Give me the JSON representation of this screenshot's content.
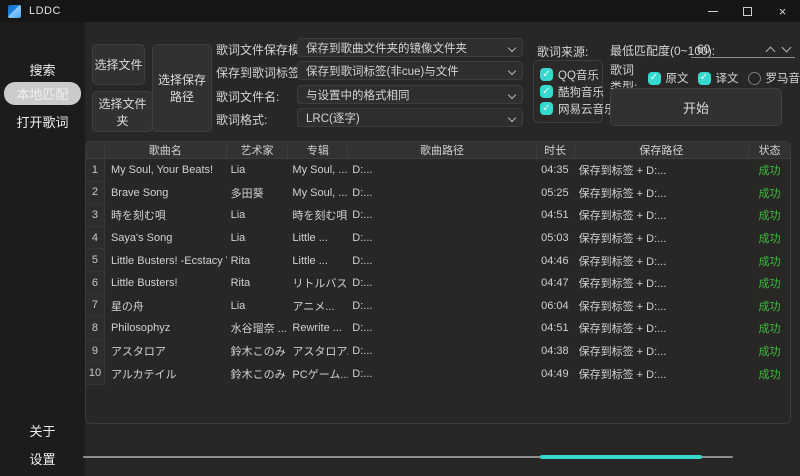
{
  "window": {
    "title": "LDDC"
  },
  "sidebar": {
    "items": [
      {
        "label": "搜索"
      },
      {
        "label": "本地匹配",
        "active": true
      },
      {
        "label": "打开歌词"
      }
    ],
    "footer": [
      {
        "label": "关于"
      },
      {
        "label": "设置"
      }
    ]
  },
  "toolbar": {
    "select_file": "选择文件",
    "select_folder": "选择文件夹",
    "select_save_path": "选择保存路径",
    "fields": [
      {
        "label": "歌词文件保存模式:",
        "value": "保存到歌曲文件夹的镜像文件夹"
      },
      {
        "label": "保存到歌词标签:",
        "value": "保存到歌词标签(非cue)与文件"
      },
      {
        "label": "歌词文件名:",
        "value": "与设置中的格式相同"
      },
      {
        "label": "歌词格式:",
        "value": "LRC(逐字)"
      }
    ],
    "source": {
      "label": "歌词来源:",
      "options": [
        {
          "label": "QQ音乐",
          "checked": true
        },
        {
          "label": "酷狗音乐",
          "checked": true
        },
        {
          "label": "网易云音乐",
          "checked": true
        }
      ]
    },
    "match": {
      "label": "最低匹配度(0~100):",
      "value": "60"
    },
    "types": {
      "label": "歌词类型:",
      "options": [
        {
          "label": "原文",
          "checked": true
        },
        {
          "label": "译文",
          "checked": true
        },
        {
          "label": "罗马音",
          "checked": false
        }
      ]
    },
    "start": "开始"
  },
  "table": {
    "headers": [
      "歌曲名",
      "艺术家",
      "专辑",
      "歌曲路径",
      "时长",
      "保存路径",
      "状态"
    ],
    "rows": [
      {
        "num": "1",
        "song": "My Soul, Your Beats!",
        "artist": "Lia",
        "album": "My Soul, ...",
        "path": "D:...",
        "duration": "04:35",
        "save": "保存到标签 + D:...",
        "status": "成功"
      },
      {
        "num": "2",
        "song": "Brave Song",
        "artist": "多田葵",
        "album": "My Soul, ...",
        "path": "D:...",
        "duration": "05:25",
        "save": "保存到标签 + D:...",
        "status": "成功"
      },
      {
        "num": "3",
        "song": "時を刻む唄",
        "artist": "Lia",
        "album": "時を刻む唄 ...",
        "path": "D:...",
        "duration": "04:51",
        "save": "保存到标签 + D:...",
        "status": "成功"
      },
      {
        "num": "4",
        "song": "Saya's Song",
        "artist": "Lia",
        "album": "Little ...",
        "path": "D:...",
        "duration": "05:03",
        "save": "保存到标签 + D:...",
        "status": "成功"
      },
      {
        "num": "5",
        "song": "Little Busters! -Ecstacy Ver.-",
        "artist": "Rita",
        "album": "Little ...",
        "path": "D:...",
        "duration": "04:46",
        "save": "保存到标签 + D:...",
        "status": "成功"
      },
      {
        "num": "6",
        "song": "Little Busters!",
        "artist": "Rita",
        "album": "リトルバス...",
        "path": "D:...",
        "duration": "04:47",
        "save": "保存到标签 + D:...",
        "status": "成功"
      },
      {
        "num": "7",
        "song": "星の舟",
        "artist": "Lia",
        "album": "アニメ...",
        "path": "D:...",
        "duration": "06:04",
        "save": "保存到标签 + D:...",
        "status": "成功"
      },
      {
        "num": "8",
        "song": "Philosophyz",
        "artist": "水谷瑠奈 ...",
        "album": "Rewrite ...",
        "path": "D:...",
        "duration": "04:51",
        "save": "保存到标签 + D:...",
        "status": "成功"
      },
      {
        "num": "9",
        "song": "アスタロア",
        "artist": "鈴木このみ",
        "album": "アスタロア/...",
        "path": "D:...",
        "duration": "04:38",
        "save": "保存到标签 + D:...",
        "status": "成功"
      },
      {
        "num": "10",
        "song": "アルカテイル",
        "artist": "鈴木このみ",
        "album": "PCゲーム...",
        "path": "D:...",
        "duration": "04:49",
        "save": "保存到标签 + D:...",
        "status": "成功"
      }
    ]
  },
  "colors": {
    "accent": "#36d9ce",
    "success": "#3cbb3c"
  }
}
